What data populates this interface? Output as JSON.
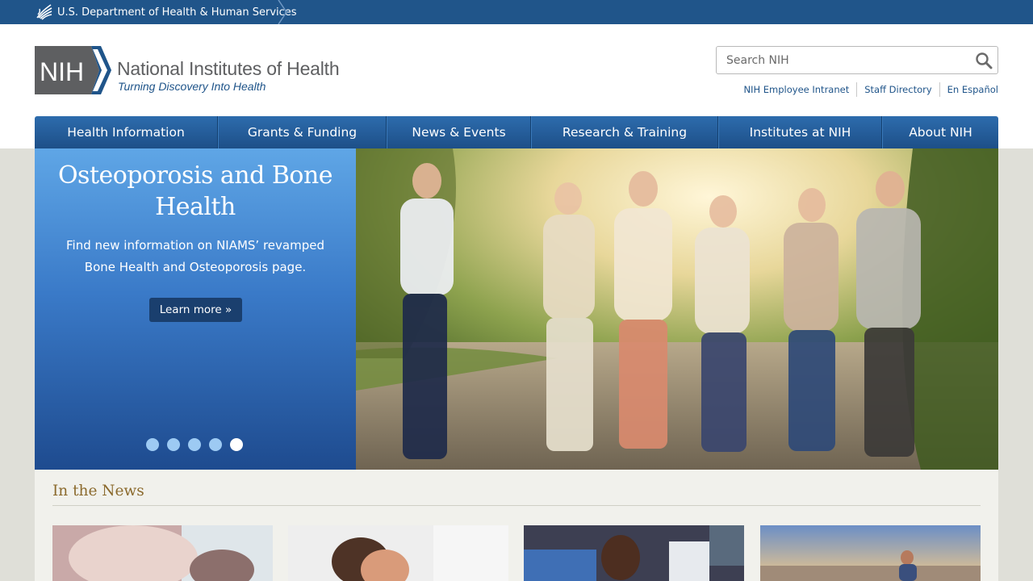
{
  "hhs": {
    "label": "U.S. Department of Health & Human Services",
    "icon": "hhs-eagle-icon"
  },
  "header": {
    "logo_abbr": "NIH",
    "logo_name": "National Institutes of Health",
    "logo_tagline": "Turning Discovery Into Health",
    "search_placeholder": "Search NIH",
    "search_icon": "search-icon",
    "links": [
      "NIH Employee Intranet",
      "Staff Directory",
      "En Español"
    ]
  },
  "nav": {
    "items": [
      "Health Information",
      "Grants & Funding",
      "News & Events",
      "Research & Training",
      "Institutes at NIH",
      "About NIH"
    ]
  },
  "hero": {
    "title": "Osteoporosis and Bone Health",
    "text": "Find new information on NIAMS’ revamped Bone Health and Osteoporosis page.",
    "button": "Learn more »",
    "slides": 5,
    "active_slide": 5
  },
  "news": {
    "title": "In the News"
  },
  "colors": {
    "brand_blue": "#20558a",
    "nav_blue": "#2d6cad",
    "news_heading": "#8b6a2d"
  }
}
